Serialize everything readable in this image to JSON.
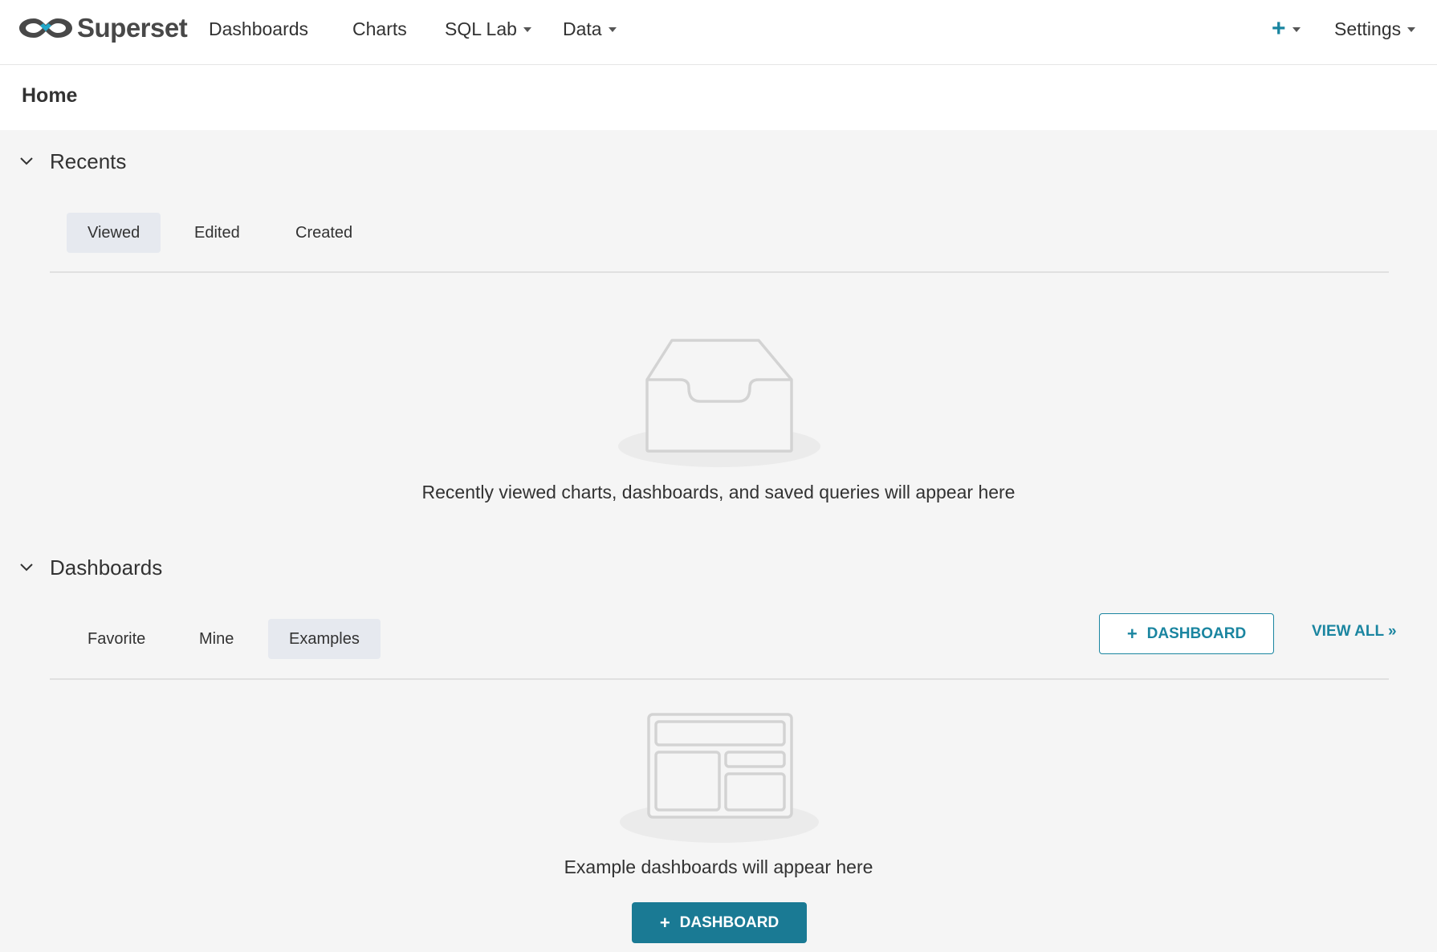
{
  "colors": {
    "brand_primary": "#1a85a0",
    "button_primary": "#1a7a94",
    "active_tab": "#e6e9ef",
    "background": "#f5f5f5"
  },
  "navbar": {
    "brand": "Superset",
    "brand_icon": "superset-logo-icon",
    "items": [
      {
        "label": "Dashboards",
        "has_dropdown": false
      },
      {
        "label": "Charts",
        "has_dropdown": false
      },
      {
        "label": "SQL Lab",
        "has_dropdown": true
      },
      {
        "label": "Data",
        "has_dropdown": true
      }
    ],
    "new_menu": {
      "icon": "plus-icon",
      "glyph": "+",
      "has_dropdown": true
    },
    "settings": {
      "label": "Settings",
      "has_dropdown": true
    }
  },
  "page": {
    "title": "Home"
  },
  "recents": {
    "title": "Recents",
    "collapse_icon": "chevron-down-icon",
    "tabs": [
      {
        "label": "Viewed",
        "active": true
      },
      {
        "label": "Edited",
        "active": false
      },
      {
        "label": "Created",
        "active": false
      }
    ],
    "empty_icon": "empty-inbox-icon",
    "empty_text": "Recently viewed charts, dashboards, and saved queries will appear here"
  },
  "dashboards": {
    "title": "Dashboards",
    "collapse_icon": "chevron-down-icon",
    "tabs": [
      {
        "label": "Favorite",
        "active": false
      },
      {
        "label": "Mine",
        "active": false
      },
      {
        "label": "Examples",
        "active": true
      }
    ],
    "add_button_label": "DASHBOARD",
    "add_button_glyph": "+",
    "view_all_label": "VIEW ALL »",
    "empty_icon": "empty-dashboard-icon",
    "empty_text": "Example dashboards will appear here",
    "empty_button_label": "DASHBOARD",
    "empty_button_glyph": "+"
  }
}
